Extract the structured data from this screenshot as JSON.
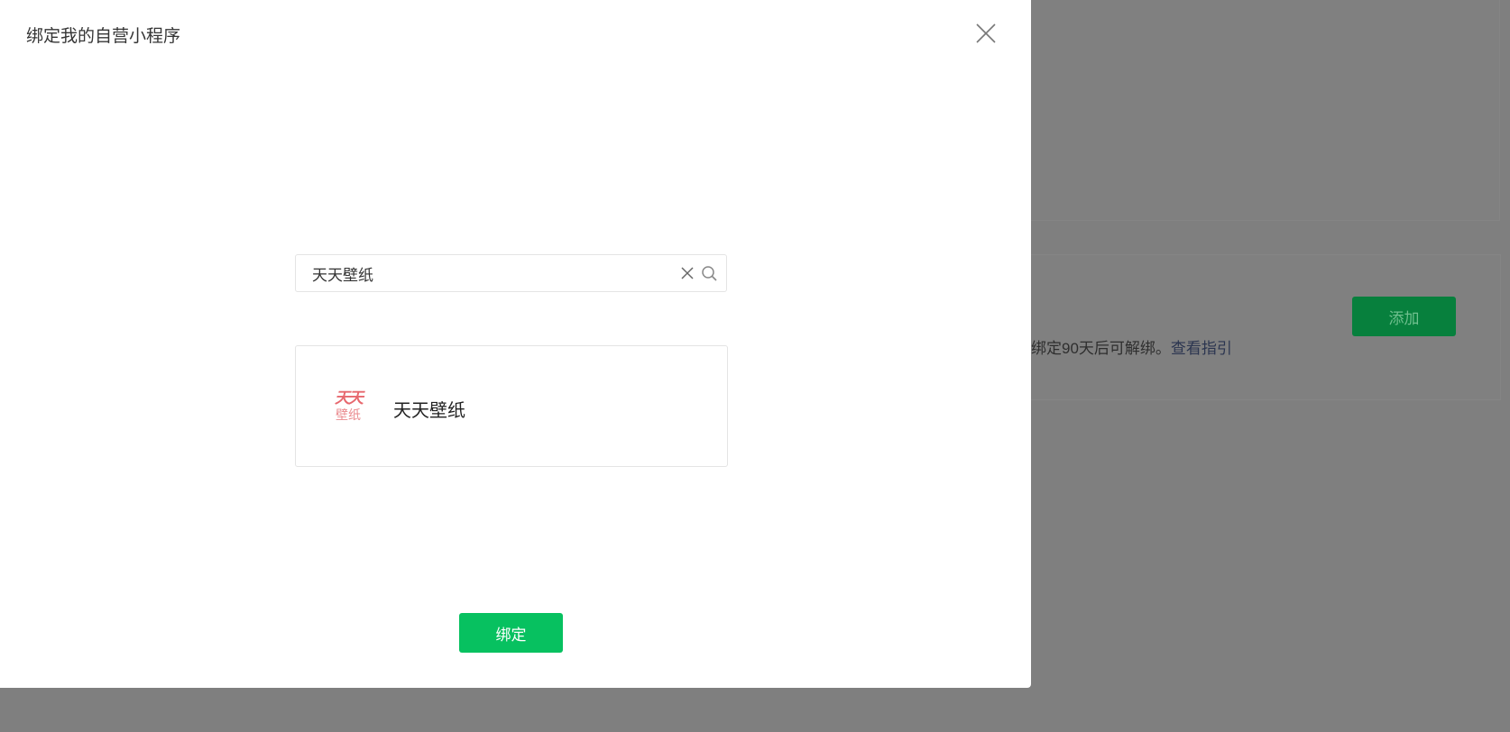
{
  "modal": {
    "title": "绑定我的自营小程序",
    "search": {
      "value": "天天壁纸",
      "placeholder": ""
    },
    "results": [
      {
        "name": "天天壁纸",
        "logo_line1": "天天",
        "logo_line2": "壁纸"
      }
    ],
    "bind_label": "绑定"
  },
  "background": {
    "add_label": "添加",
    "note_text": "绑定90天后可解绑。",
    "note_link": "查看指引"
  },
  "colors": {
    "primary": "#07c160",
    "overlay": "#7f7f7f",
    "logo": "#e7686e"
  },
  "icons": [
    "close-icon",
    "clear-icon",
    "search-icon"
  ]
}
